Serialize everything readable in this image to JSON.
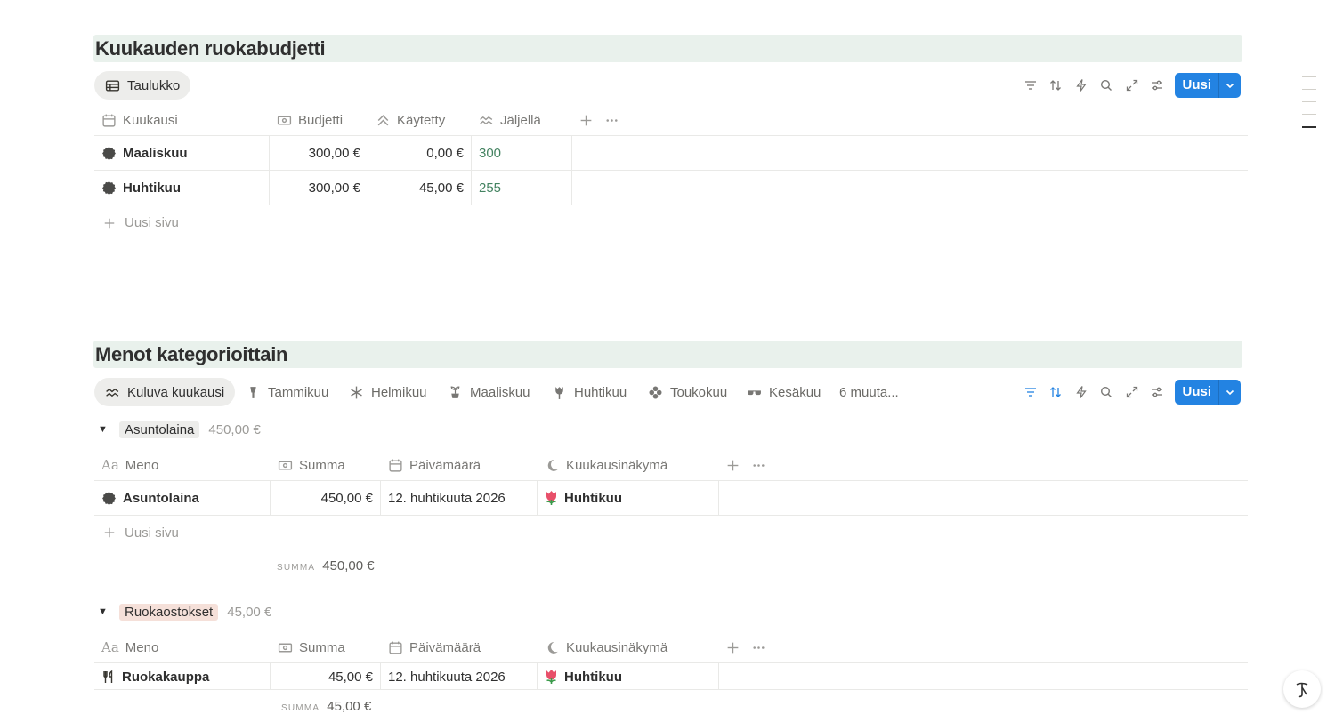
{
  "budget": {
    "title": "Kuukauden ruokabudjetti",
    "view_tab": "Taulukko",
    "new_button": "Uusi",
    "columns": [
      "Kuukausi",
      "Budjetti",
      "Käytetty",
      "Jäljellä"
    ],
    "rows": [
      {
        "month": "Maaliskuu",
        "budget": "300,00 €",
        "spent": "0,00 €",
        "left": "300"
      },
      {
        "month": "Huhtikuu",
        "budget": "300,00 €",
        "spent": "45,00 €",
        "left": "255"
      }
    ],
    "new_page": "Uusi sivu"
  },
  "expenses": {
    "title": "Menot kategorioittain",
    "tabs": [
      {
        "label": "Kuluva kuukausi",
        "icon": "wave-icon"
      },
      {
        "label": "Tammikuu",
        "icon": "torch-icon"
      },
      {
        "label": "Helmikuu",
        "icon": "snowflake-icon"
      },
      {
        "label": "Maaliskuu",
        "icon": "sprout-icon"
      },
      {
        "label": "Huhtikuu",
        "icon": "tulip-icon"
      },
      {
        "label": "Toukokuu",
        "icon": "flower-icon"
      },
      {
        "label": "Kesäkuu",
        "icon": "sunglasses-icon"
      }
    ],
    "more_tabs": "6 muuta...",
    "new_button": "Uusi",
    "columns": [
      "Meno",
      "Summa",
      "Päivämäärä",
      "Kuukausinäkymä"
    ],
    "summa_label": "SUMMA",
    "groups": [
      {
        "name": "Asuntolaina",
        "total": "450,00 €",
        "tag_color": "#ededeb",
        "rows": [
          {
            "name": "Asuntolaina",
            "sum": "450,00 €",
            "date": "12. huhtikuuta 2026",
            "month": "Huhtikuu"
          }
        ],
        "new_page": "Uusi sivu",
        "summa": "450,00 €"
      },
      {
        "name": "Ruokaostokset",
        "total": "45,00 €",
        "tag_color": "#f5e0d9",
        "rows": [
          {
            "name": "Ruokakauppa",
            "sum": "45,00 €",
            "date": "12. huhtikuuta 2026",
            "month": "Huhtikuu"
          }
        ],
        "summa": "45,00 €"
      }
    ]
  },
  "colors": {
    "accent": "#2383e2",
    "heading_bg": "#e9f1ec",
    "green_text": "#448361"
  }
}
